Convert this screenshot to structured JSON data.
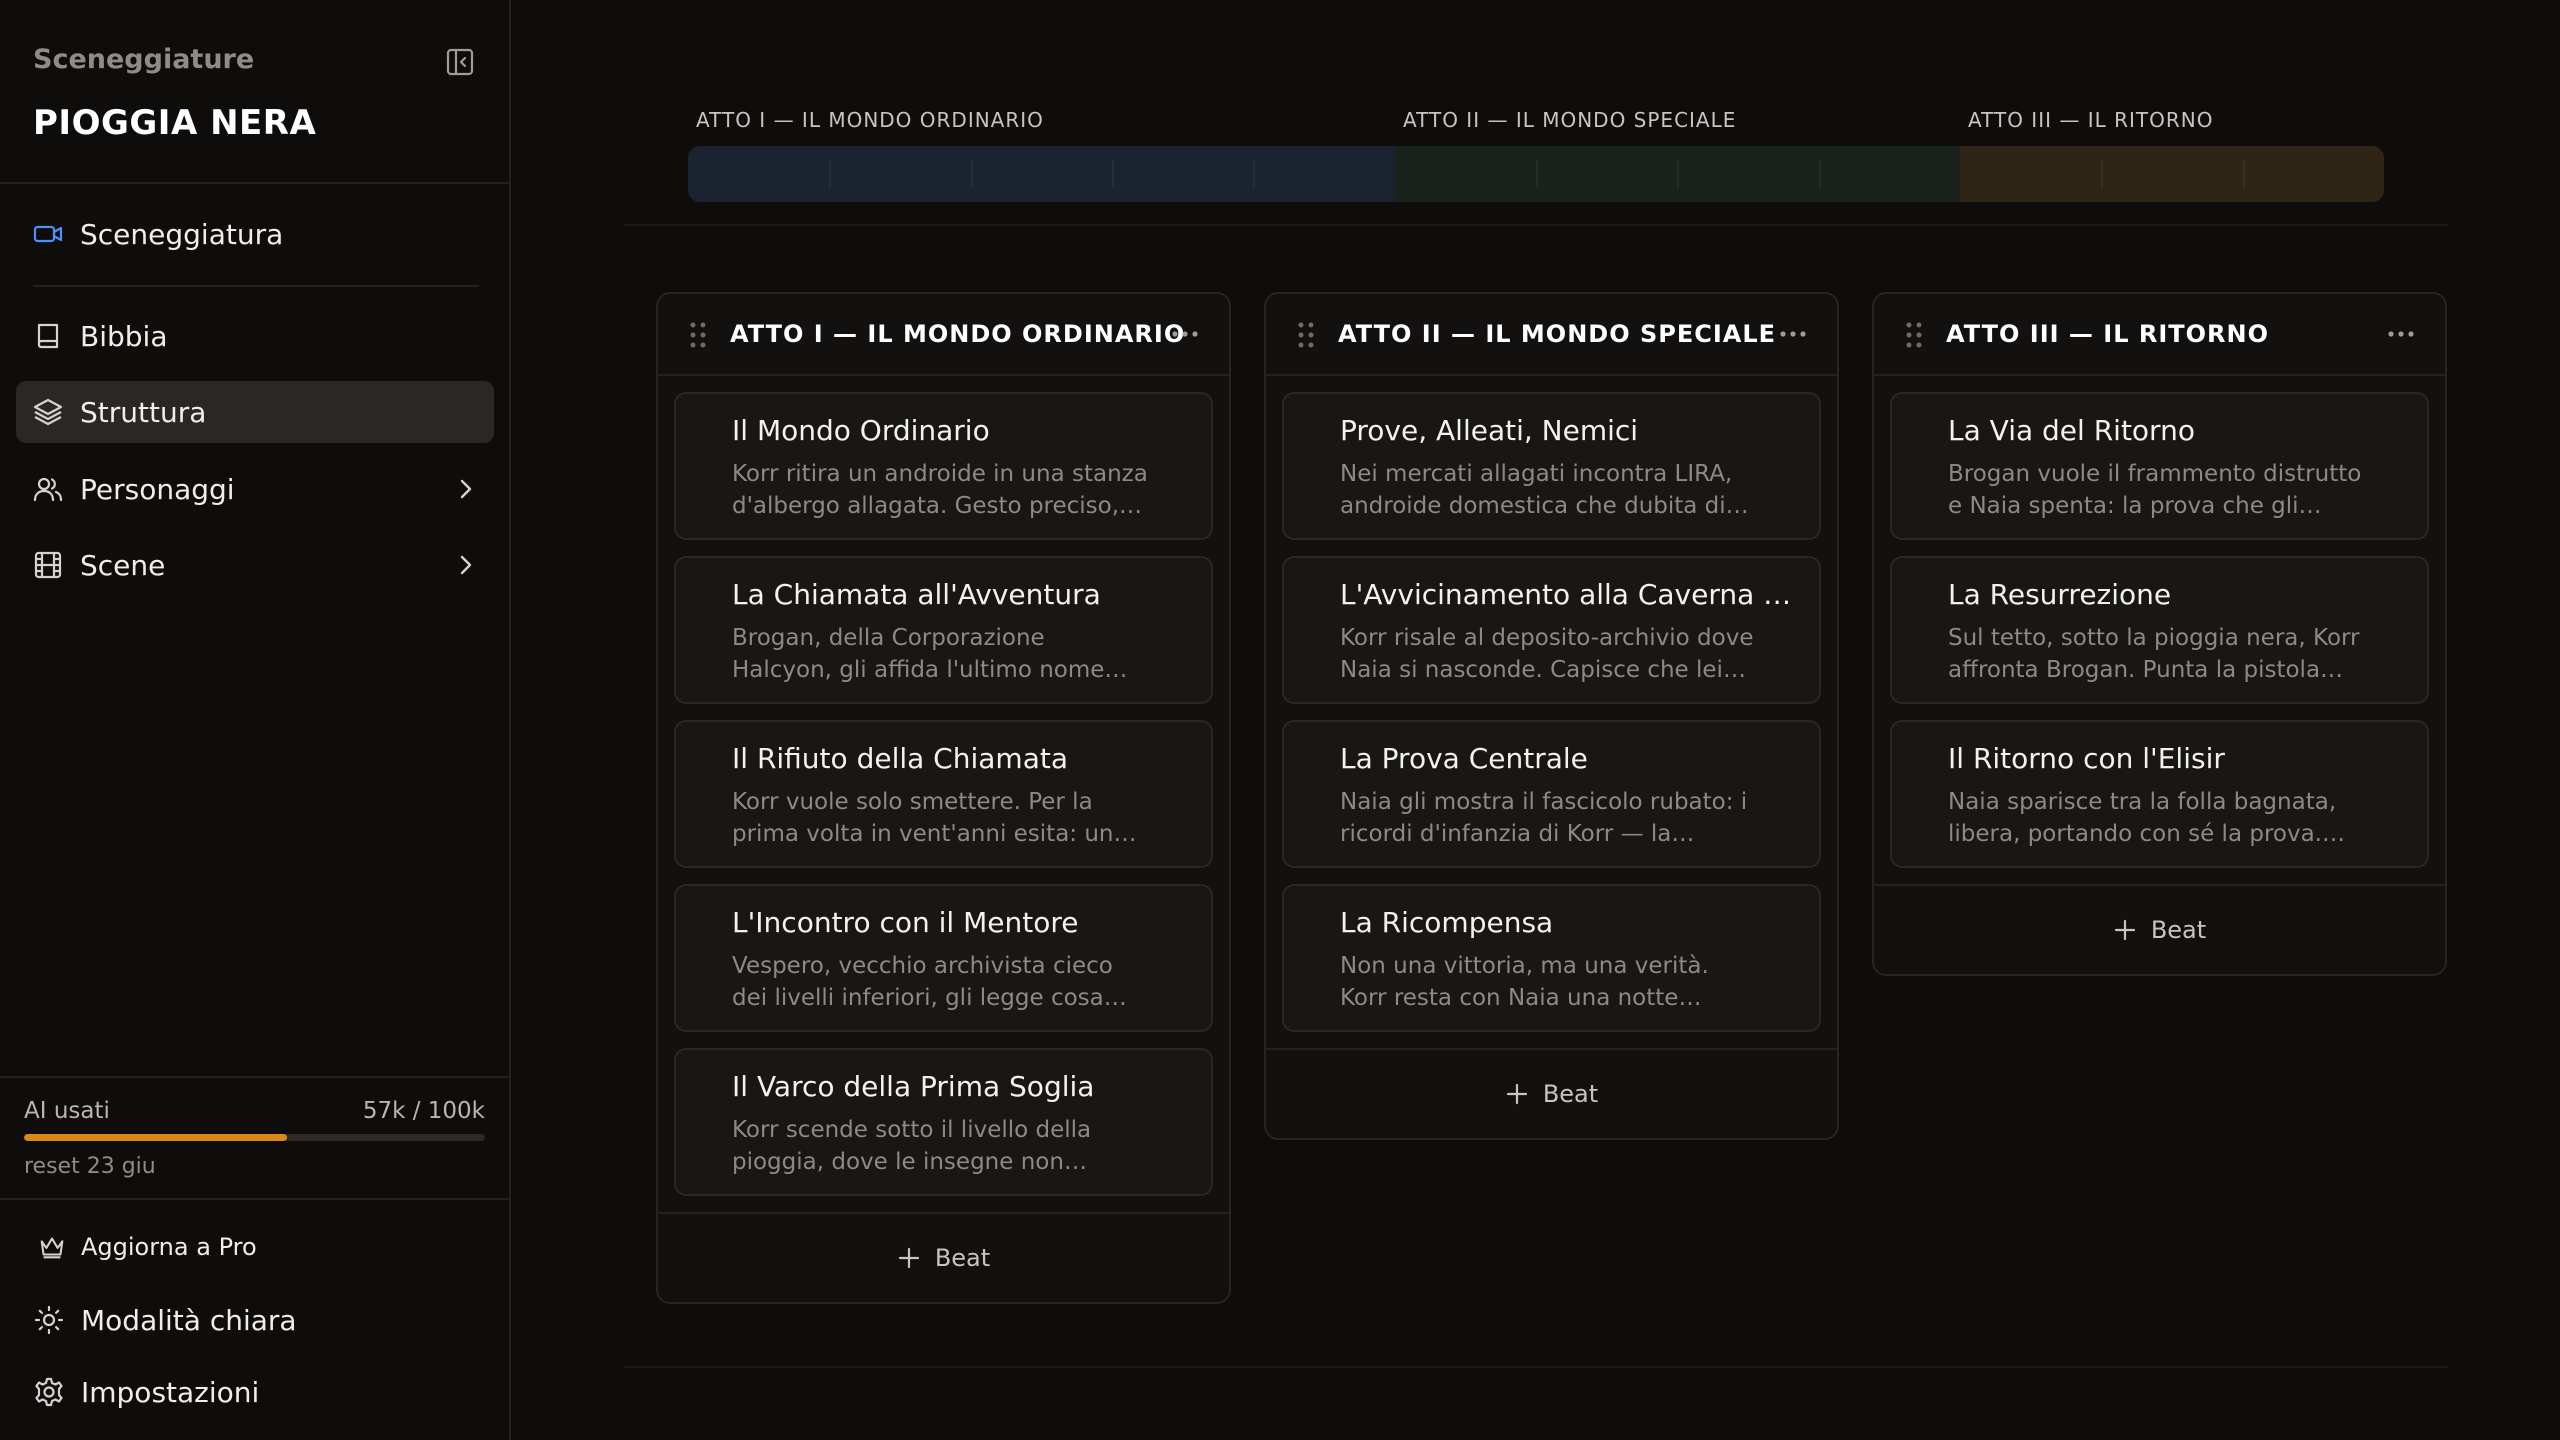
{
  "sidebar": {
    "caption": "Sceneggiature",
    "project_title": "PIOGGIA NERA",
    "items": [
      {
        "label": "Sceneggiatura",
        "icon": "video-camera-icon"
      },
      {
        "label": "Bibbia",
        "icon": "book-icon"
      },
      {
        "label": "Struttura",
        "icon": "layers-icon",
        "active": true
      },
      {
        "label": "Personaggi",
        "icon": "users-icon"
      },
      {
        "label": "Scene",
        "icon": "film-icon"
      }
    ],
    "usage": {
      "label": "AI usati",
      "count": "57k / 100k",
      "fraction": 0.57,
      "reset": "reset 23 giu",
      "bar_color": "#d9891a"
    },
    "footer": {
      "upgrade": "Aggiorna a Pro",
      "theme": "Modalità chiara",
      "settings": "Impostazioni"
    }
  },
  "timeline": {
    "acts": [
      {
        "label": "ATTO I — IL MONDO ORDINARIO",
        "color": "#1b2230",
        "beats": 5
      },
      {
        "label": "ATTO II — IL MONDO SPECIALE",
        "color": "#1a221e",
        "beats": 4
      },
      {
        "label": "ATTO III — IL RITORNO",
        "color": "#2f2516",
        "beats": 3
      }
    ]
  },
  "acts": [
    {
      "title": "ATTO I — IL MONDO ORDINARIO",
      "beats": [
        {
          "title": "Il Mondo Ordinario",
          "desc": "Korr ritira un androide in una stanza d'albergo allagata. Gesto preciso,…"
        },
        {
          "title": "La Chiamata all'Avventura",
          "desc": "Brogan, della Corporazione Halcyon, gli affida l'ultimo nome prima della…"
        },
        {
          "title": "Il Rifiuto della Chiamata",
          "desc": "Korr vuole solo smettere. Per la prima volta in vent'anni esita: un modello…"
        },
        {
          "title": "L'Incontro con il Mentore",
          "desc": "Vespero, vecchio archivista cieco dei livelli inferiori, gli legge cosa contien…"
        },
        {
          "title": "Il Varco della Prima Soglia",
          "desc": "Korr scende sotto il livello della pioggia, dove le insegne non arrivan…"
        }
      ],
      "add_label": "Beat"
    },
    {
      "title": "ATTO II — IL MONDO SPECIALE",
      "beats": [
        {
          "title": "Prove, Alleati, Nemici",
          "desc": "Nei mercati allagati incontra LIRA, androide domestica che dubita di…"
        },
        {
          "title": "L'Avvicinamento alla Caverna pi…",
          "desc": "Korr risale al deposito-archivio dove Naia si nasconde. Capisce che lei no…"
        },
        {
          "title": "La Prova Centrale",
          "desc": "Naia gli mostra il fascicolo rubato: i ricordi d'infanzia di Korr — la madre, i…"
        },
        {
          "title": "La Ricompensa",
          "desc": "Non una vittoria, ma una verità. Korr resta con Naia una notte intera…"
        }
      ],
      "add_label": "Beat"
    },
    {
      "title": "ATTO III — IL RITORNO",
      "beats": [
        {
          "title": "La Via del Ritorno",
          "desc": "Brogan vuole il frammento distrutto e Naia spenta: la prova che gli impianti…"
        },
        {
          "title": "La Resurrezione",
          "desc": "Sul tetto, sotto la pioggia nera, Korr affronta Brogan. Punta la pistola su…"
        },
        {
          "title": "Il Ritorno con l'Elisir",
          "desc": "Naia sparisce tra la folla bagnata, libera, portando con sé la prova. Korr…"
        }
      ],
      "add_label": "Beat"
    }
  ]
}
